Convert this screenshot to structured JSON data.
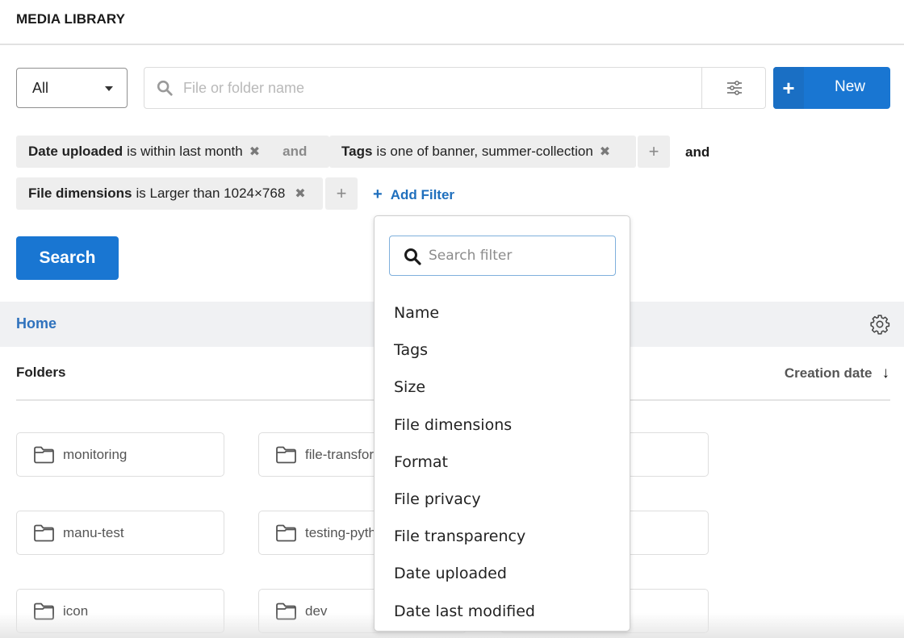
{
  "header": {
    "title": "MEDIA LIBRARY"
  },
  "toolbar": {
    "type_select": {
      "value": "All"
    },
    "search": {
      "placeholder": "File or folder name",
      "value": ""
    },
    "new_button": {
      "plus": "+",
      "label": "New"
    }
  },
  "filters": {
    "row1": [
      {
        "field": "Date uploaded",
        "condition": "is within last month",
        "remove": "✖",
        "joiner": "and"
      },
      {
        "field": "Tags",
        "condition": "is one of banner, summer-collection",
        "remove": "✖"
      }
    ],
    "row1_plus": "+",
    "row1_joiner": "and",
    "row2": [
      {
        "field": "File dimensions",
        "condition": "is Larger than 1024×768",
        "remove": "✖"
      }
    ],
    "row2_plus": "+",
    "add_filter": {
      "plus": "+",
      "label": "Add Filter"
    }
  },
  "search_button": {
    "label": "Search"
  },
  "breadcrumb": {
    "home": "Home"
  },
  "folders": {
    "title": "Folders",
    "sort_label": "Creation date",
    "sort_arrow": "↓",
    "items": [
      {
        "name": "monitoring"
      },
      {
        "name": "file-transformations"
      },
      {
        "name": ""
      },
      {
        "name": "manu-test"
      },
      {
        "name": "testing-python"
      },
      {
        "name": ""
      },
      {
        "name": "icon"
      },
      {
        "name": "dev"
      },
      {
        "name": ""
      }
    ]
  },
  "filter_dropdown": {
    "search_placeholder": "Search filter",
    "search_value": "",
    "options": [
      "Name",
      "Tags",
      "Size",
      "File dimensions",
      "Format",
      "File privacy",
      "File transparency",
      "Date uploaded",
      "Date last modified"
    ]
  },
  "colors": {
    "primary": "#1976d2",
    "link": "#2f72bd",
    "chip_bg": "#eeeeee",
    "breadcrumb_bg": "#f0f1f3"
  }
}
